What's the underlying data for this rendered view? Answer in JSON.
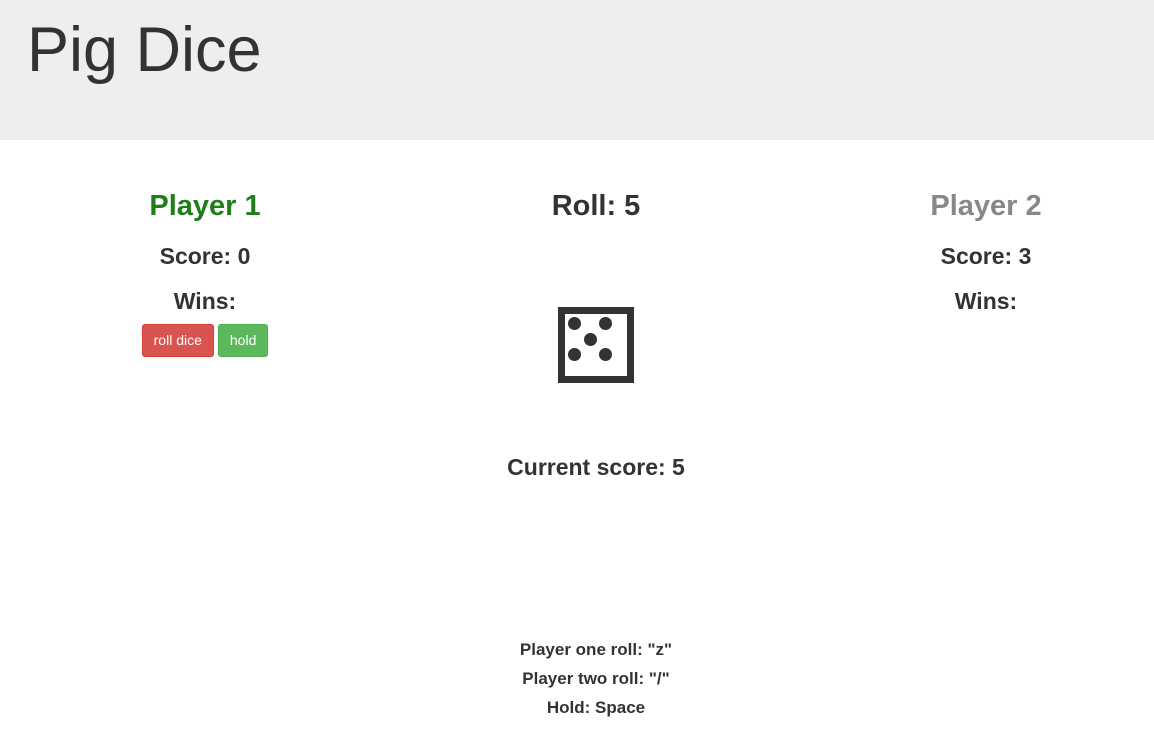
{
  "header": {
    "title": "Pig Dice"
  },
  "player1": {
    "name": "Player 1",
    "score_label": "Score: 0",
    "wins_label": "Wins:",
    "roll_button": "roll dice",
    "hold_button": "hold",
    "color": "#1f7e1a"
  },
  "center": {
    "roll_label": "Roll: 5",
    "die_value": 5,
    "current_score_label": "Current score: 5"
  },
  "player2": {
    "name": "Player 2",
    "score_label": "Score: 3",
    "wins_label": "Wins:",
    "color": "#888888"
  },
  "controls": {
    "player_one_roll": "Player one roll: \"z\"",
    "player_two_roll": "Player two roll: \"/\"",
    "hold": "Hold: Space"
  },
  "colors": {
    "header_bg": "#eeeeee",
    "roll_button_bg": "#d9534f",
    "hold_button_bg": "#5cb85c",
    "text": "#333333"
  }
}
